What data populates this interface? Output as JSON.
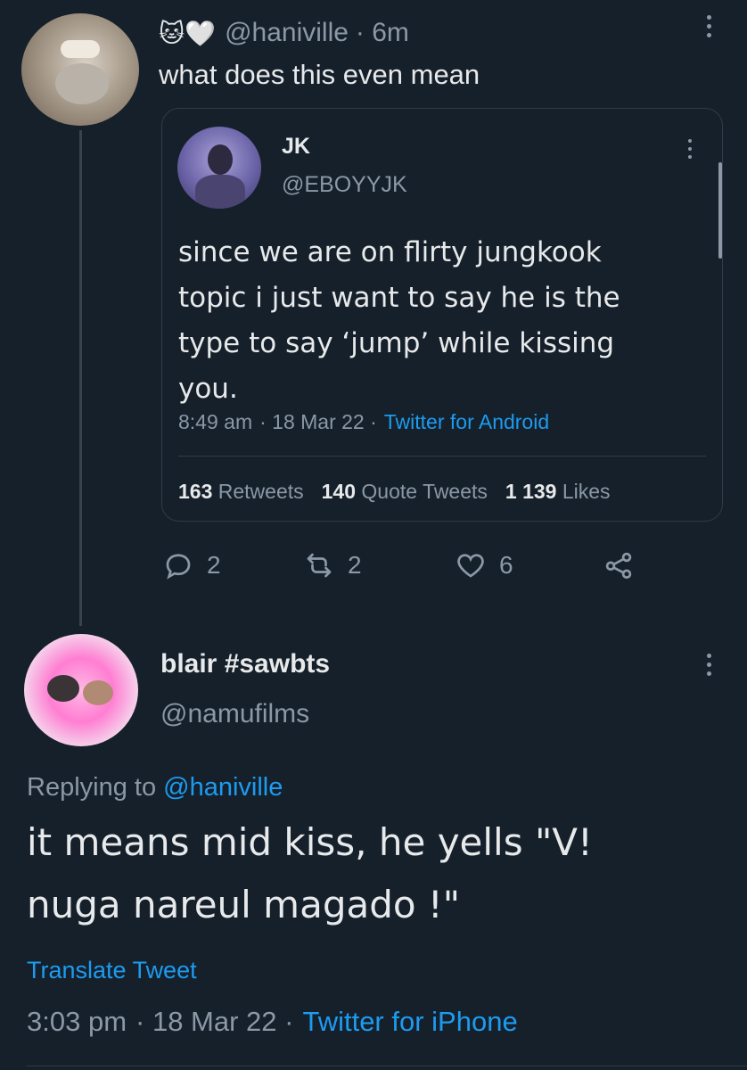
{
  "first_tweet": {
    "emoji": "🐱🤍",
    "handle": "@haniville",
    "time": "· 6m",
    "text": "what does this even mean"
  },
  "quoted_tweet": {
    "name": "JK",
    "handle": "@EBOYYJK",
    "text": "since we are on flirty jungkook topic i just want to say he is the type to say ‘jump’ while kissing you.",
    "time": "8:49 am",
    "date": "· 18 Mar 22 ·",
    "source": "Twitter for Android",
    "stats": {
      "retweets_count": "163",
      "retweets_label": "Retweets",
      "quotes_count": "140",
      "quotes_label": "Quote Tweets",
      "likes_count": "1 139",
      "likes_label": "Likes"
    }
  },
  "actions": {
    "replies": "2",
    "retweets": "2",
    "likes": "6"
  },
  "reply_tweet": {
    "name": "blair #sawbts",
    "handle": "@namufilms",
    "replying_prefix": "Replying to",
    "replying_handle": "@haniville",
    "text_line1": "it means mid kiss, he yells \"V!",
    "text_line2": "nuga nareul magado !\"",
    "translate": "Translate Tweet",
    "time": "3:03 pm",
    "date": "· 18 Mar 22 ·",
    "source": "Twitter for iPhone"
  },
  "colors": {
    "background": "#15202b",
    "accent": "#1d9bf0",
    "muted": "#8b98a5"
  }
}
